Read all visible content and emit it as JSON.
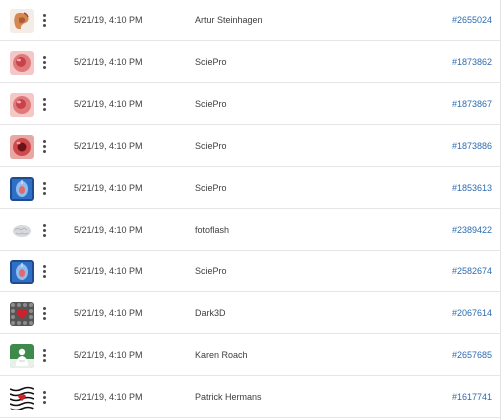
{
  "rows": [
    {
      "thumbnail": "digestive-organs-thumbnail",
      "date": "5/21/19, 4:10 PM",
      "author": "Artur Steinhagen",
      "asset_id": "#2655024"
    },
    {
      "thumbnail": "pink-tissue-thumbnail",
      "date": "5/21/19, 4:10 PM",
      "author": "SciePro",
      "asset_id": "#1873862"
    },
    {
      "thumbnail": "pink-tissue-thumbnail",
      "date": "5/21/19, 4:10 PM",
      "author": "SciePro",
      "asset_id": "#1873867"
    },
    {
      "thumbnail": "red-tissue-thumbnail",
      "date": "5/21/19, 4:10 PM",
      "author": "SciePro",
      "asset_id": "#1873886"
    },
    {
      "thumbnail": "blue-anatomy-thumbnail",
      "date": "5/21/19, 4:10 PM",
      "author": "SciePro",
      "asset_id": "#1853613"
    },
    {
      "thumbnail": "brain-thumbnail",
      "date": "5/21/19, 4:10 PM",
      "author": "fotoflash",
      "asset_id": "#2389422"
    },
    {
      "thumbnail": "blue-anatomy-thumbnail",
      "date": "5/21/19, 4:10 PM",
      "author": "SciePro",
      "asset_id": "#2582674"
    },
    {
      "thumbnail": "heart-pattern-thumbnail",
      "date": "5/21/19, 4:10 PM",
      "author": "Dark3D",
      "asset_id": "#2067614"
    },
    {
      "thumbnail": "figure-green-thumbnail",
      "date": "5/21/19, 4:10 PM",
      "author": "Karen Roach",
      "asset_id": "#2657685"
    },
    {
      "thumbnail": "optical-pattern-thumbnail",
      "date": "5/21/19, 4:10 PM",
      "author": "Patrick Hermans",
      "asset_id": "#1617741"
    }
  ]
}
